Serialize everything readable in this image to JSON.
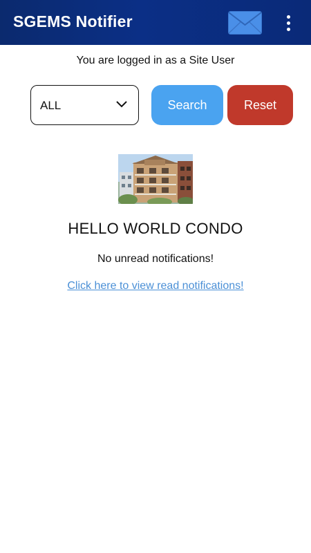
{
  "appbar": {
    "title": "SGEMS Notifier",
    "icons": [
      "mail-icon",
      "more-vert-icon"
    ]
  },
  "status": {
    "login_text": "You are logged in as a Site User"
  },
  "filter": {
    "selected": "ALL"
  },
  "actions": {
    "search_label": "Search",
    "reset_label": "Reset"
  },
  "site": {
    "name": "HELLO WORLD CONDO",
    "no_unread_text": "No unread notifications!",
    "read_link_text": "Click here to view read notifications!"
  },
  "colors": {
    "appbar": "#0b2f86",
    "search": "#4aa3f0",
    "reset": "#c0392b",
    "link": "#4a8fd6"
  }
}
